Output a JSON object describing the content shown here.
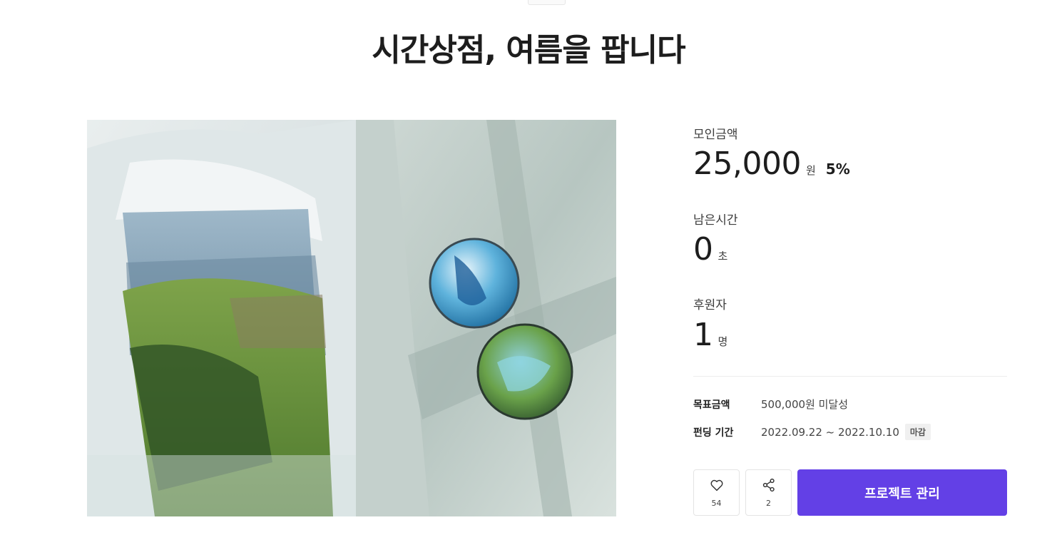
{
  "project": {
    "title": "시간상점, 여름을 팝니다"
  },
  "stats": {
    "raised_label": "모인금액",
    "raised_value": "25,000",
    "raised_unit": "원",
    "raised_percent": "5%",
    "time_label": "남은시간",
    "time_value": "0",
    "time_unit": "초",
    "backers_label": "후원자",
    "backers_value": "1",
    "backers_unit": "명"
  },
  "meta": {
    "goal_key": "목표금액",
    "goal_value": "500,000원 미달성",
    "period_key": "펀딩 기간",
    "period_value": "2022.09.22 ~ 2022.10.10",
    "period_badge": "마감"
  },
  "actions": {
    "like_icon": "heart-icon",
    "like_count": "54",
    "share_icon": "share-icon",
    "share_count": "2",
    "manage_label": "프로젝트 관리",
    "accent_color": "#6340e6"
  }
}
